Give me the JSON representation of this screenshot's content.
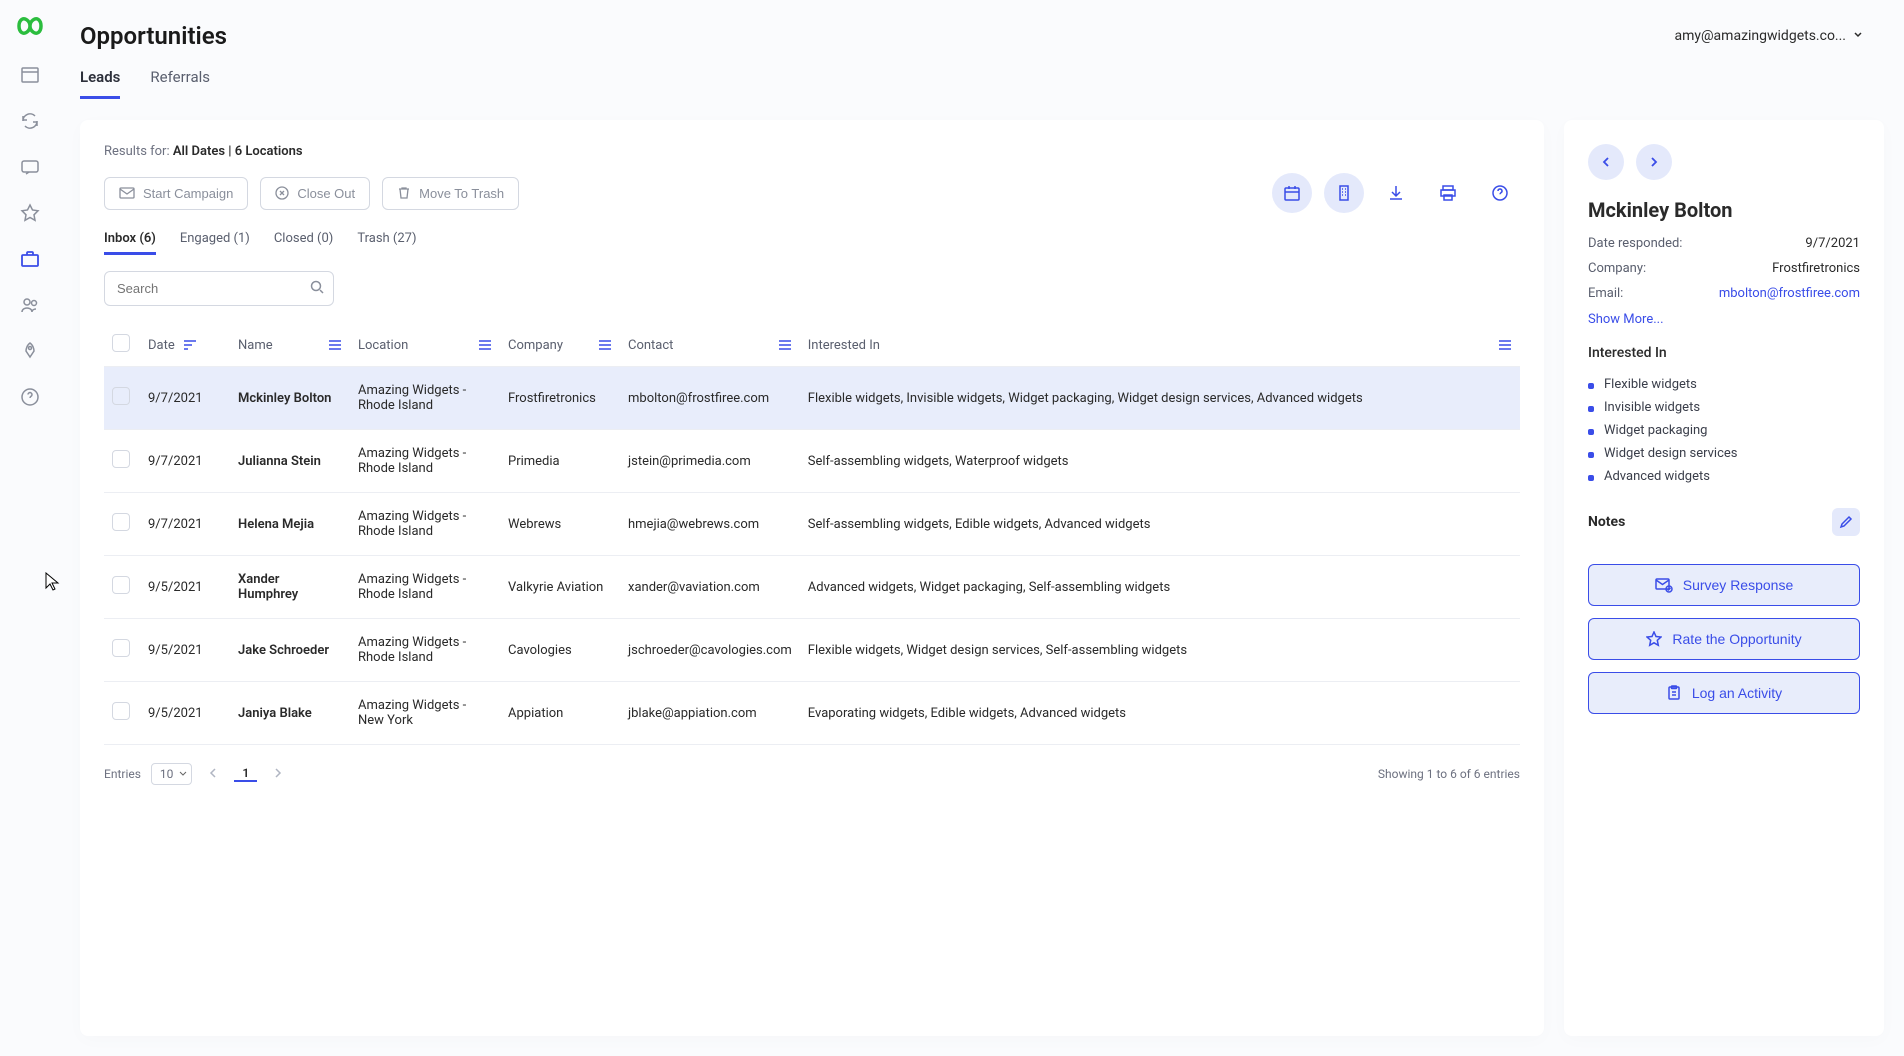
{
  "header": {
    "title": "Opportunities",
    "user_email": "amy@amazingwidgets.co..."
  },
  "tabs": {
    "leads": "Leads",
    "referrals": "Referrals"
  },
  "results": {
    "prefix": "Results for: ",
    "filter_text": "All Dates | 6 Locations"
  },
  "toolbar": {
    "start_campaign": "Start Campaign",
    "close_out": "Close Out",
    "move_to_trash": "Move To Trash"
  },
  "filter_tabs": {
    "inbox": "Inbox (6)",
    "engaged": "Engaged (1)",
    "closed": "Closed (0)",
    "trash": "Trash (27)"
  },
  "search": {
    "placeholder": "Search"
  },
  "columns": {
    "date": "Date",
    "name": "Name",
    "location": "Location",
    "company": "Company",
    "contact": "Contact",
    "interested_in": "Interested In"
  },
  "rows": [
    {
      "date": "9/7/2021",
      "name": "Mckinley Bolton",
      "location": "Amazing Widgets - Rhode Island",
      "company": "Frostfiretronics",
      "contact": "mbolton@frostfiree.com",
      "interested": "Flexible widgets, Invisible widgets, Widget packaging, Widget design services, Advanced widgets",
      "selected": true
    },
    {
      "date": "9/7/2021",
      "name": "Julianna Stein",
      "location": "Amazing Widgets - Rhode Island",
      "company": "Primedia",
      "contact": "jstein@primedia.com",
      "interested": "Self-assembling widgets, Waterproof widgets"
    },
    {
      "date": "9/7/2021",
      "name": "Helena Mejia",
      "location": "Amazing Widgets - Rhode Island",
      "company": "Webrews",
      "contact": "hmejia@webrews.com",
      "interested": "Self-assembling widgets, Edible widgets, Advanced widgets"
    },
    {
      "date": "9/5/2021",
      "name": "Xander Humphrey",
      "location": "Amazing Widgets - Rhode Island",
      "company": "Valkyrie Aviation",
      "contact": "xander@vaviation.com",
      "interested": "Advanced widgets, Widget packaging, Self-assembling widgets"
    },
    {
      "date": "9/5/2021",
      "name": "Jake Schroeder",
      "location": "Amazing Widgets - Rhode Island",
      "company": "Cavologies",
      "contact": "jschroeder@cavologies.com",
      "interested": "Flexible widgets, Widget design services, Self-assembling widgets"
    },
    {
      "date": "9/5/2021",
      "name": "Janiya Blake",
      "location": "Amazing Widgets - New York",
      "company": "Appiation",
      "contact": "jblake@appiation.com",
      "interested": "Evaporating widgets, Edible widgets, Advanced widgets"
    }
  ],
  "pager": {
    "entries_label": "Entries",
    "entries_value": "10",
    "page": "1",
    "showing": "Showing 1 to 6 of 6 entries"
  },
  "detail": {
    "name": "Mckinley Bolton",
    "date_label": "Date responded:",
    "date_value": "9/7/2021",
    "company_label": "Company:",
    "company_value": "Frostfiretronics",
    "email_label": "Email:",
    "email_value": "mbolton@frostfiree.com",
    "show_more": "Show More...",
    "interested_label": "Interested In",
    "interests": [
      "Flexible widgets",
      "Invisible widgets",
      "Widget packaging",
      "Widget design services",
      "Advanced widgets"
    ],
    "notes_label": "Notes",
    "btn_survey": "Survey Response",
    "btn_rate": "Rate the Opportunity",
    "btn_log": "Log an Activity"
  }
}
